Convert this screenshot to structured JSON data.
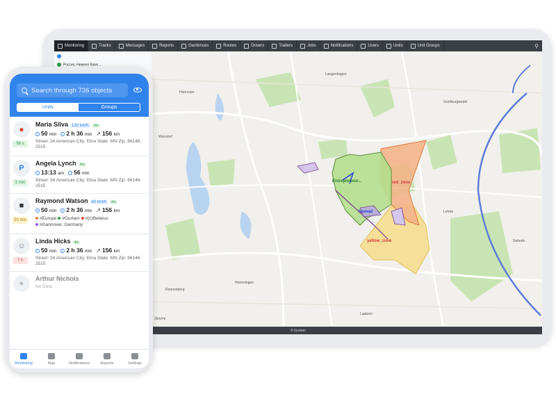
{
  "tablet": {
    "nav": [
      {
        "label": "Monitoring",
        "active": true
      },
      {
        "label": "Tracks"
      },
      {
        "label": "Messages"
      },
      {
        "label": "Reports"
      },
      {
        "label": "Geofences"
      },
      {
        "label": "Routes"
      },
      {
        "label": "Drivers"
      },
      {
        "label": "Trailers"
      },
      {
        "label": "Jobs"
      },
      {
        "label": "Notifications"
      },
      {
        "label": "Users"
      },
      {
        "label": "Units"
      },
      {
        "label": "Unit Groups"
      }
    ],
    "side_unit": "Россия, Нижнее Камч...",
    "map_labels": {
      "city": "Hannover",
      "scale": "2km/mi",
      "l1": "Langenhagen",
      "l2": "Großburgwedel",
      "l3": "Lehrte",
      "l4": "Sehnde",
      "l5": "Laatzen",
      "l6": "Hemmingen",
      "l7": "Wunstorf",
      "l8": "Ronnenberg"
    },
    "zones": {
      "red": "red_zone",
      "yellow": "yellow_zone",
      "green": "Entrepreneur...",
      "blue": "Nomad"
    },
    "footer": "© Gurtam"
  },
  "phone": {
    "search_placeholder": "Search through 736 objects",
    "tab_units": "Units",
    "tab_groups": "Groups",
    "units": [
      {
        "name": "Maria Silva",
        "speed": "120 km/h",
        "gps": "4m",
        "badge": "56 s",
        "time": "50",
        "time_u": "min",
        "dur": "2 h 36",
        "dur_u": "min",
        "dist": "156",
        "dist_u": "km",
        "addr": "Street: 34 American City: Etna State: MN Zip: 86146-2515",
        "badge_color": "#2b9b45",
        "badge_bg": "#e3f4e6"
      },
      {
        "name": "Angela Lynch",
        "gps": "4m",
        "badge": "3 min",
        "time": "13:13",
        "time_u": "am",
        "dur": "56",
        "dur_u": "min",
        "addr": "Street: 34 American City: Etna State: MN Zip: 86146-2515",
        "badge_color": "#2b9b45",
        "badge_bg": "#e3f4e6"
      },
      {
        "name": "Raymond Watson",
        "speed": "60 km/h",
        "gps": "4m",
        "badge": "20 min",
        "time": "50",
        "time_u": "min",
        "dur": "2 h 36",
        "dur_u": "min",
        "dist": "156",
        "dist_u": "km",
        "tags": [
          "#Europe",
          "#Gurtam",
          "#(c)Belarus",
          "#Gannover, Germany"
        ],
        "badge_color": "#a17b00",
        "badge_bg": "#fdf3cf"
      },
      {
        "name": "Linda Hicks",
        "gps": "4m",
        "badge": "7 h",
        "time": "50",
        "time_u": "min",
        "dur": "2 h 36",
        "dur_u": "min",
        "dist": "156",
        "dist_u": "km",
        "addr": "Street: 34 American City: Etna State: MN Zip: 86146-2515",
        "badge_color": "#c94040",
        "badge_bg": "#fde2e2"
      },
      {
        "name": "Arthur Nichols",
        "addr": "No Data"
      }
    ],
    "tabbar": [
      "Monitoring",
      "Map",
      "Notifications",
      "Reports",
      "Settings"
    ],
    "colors": {
      "accent": "#2f83eb"
    }
  }
}
